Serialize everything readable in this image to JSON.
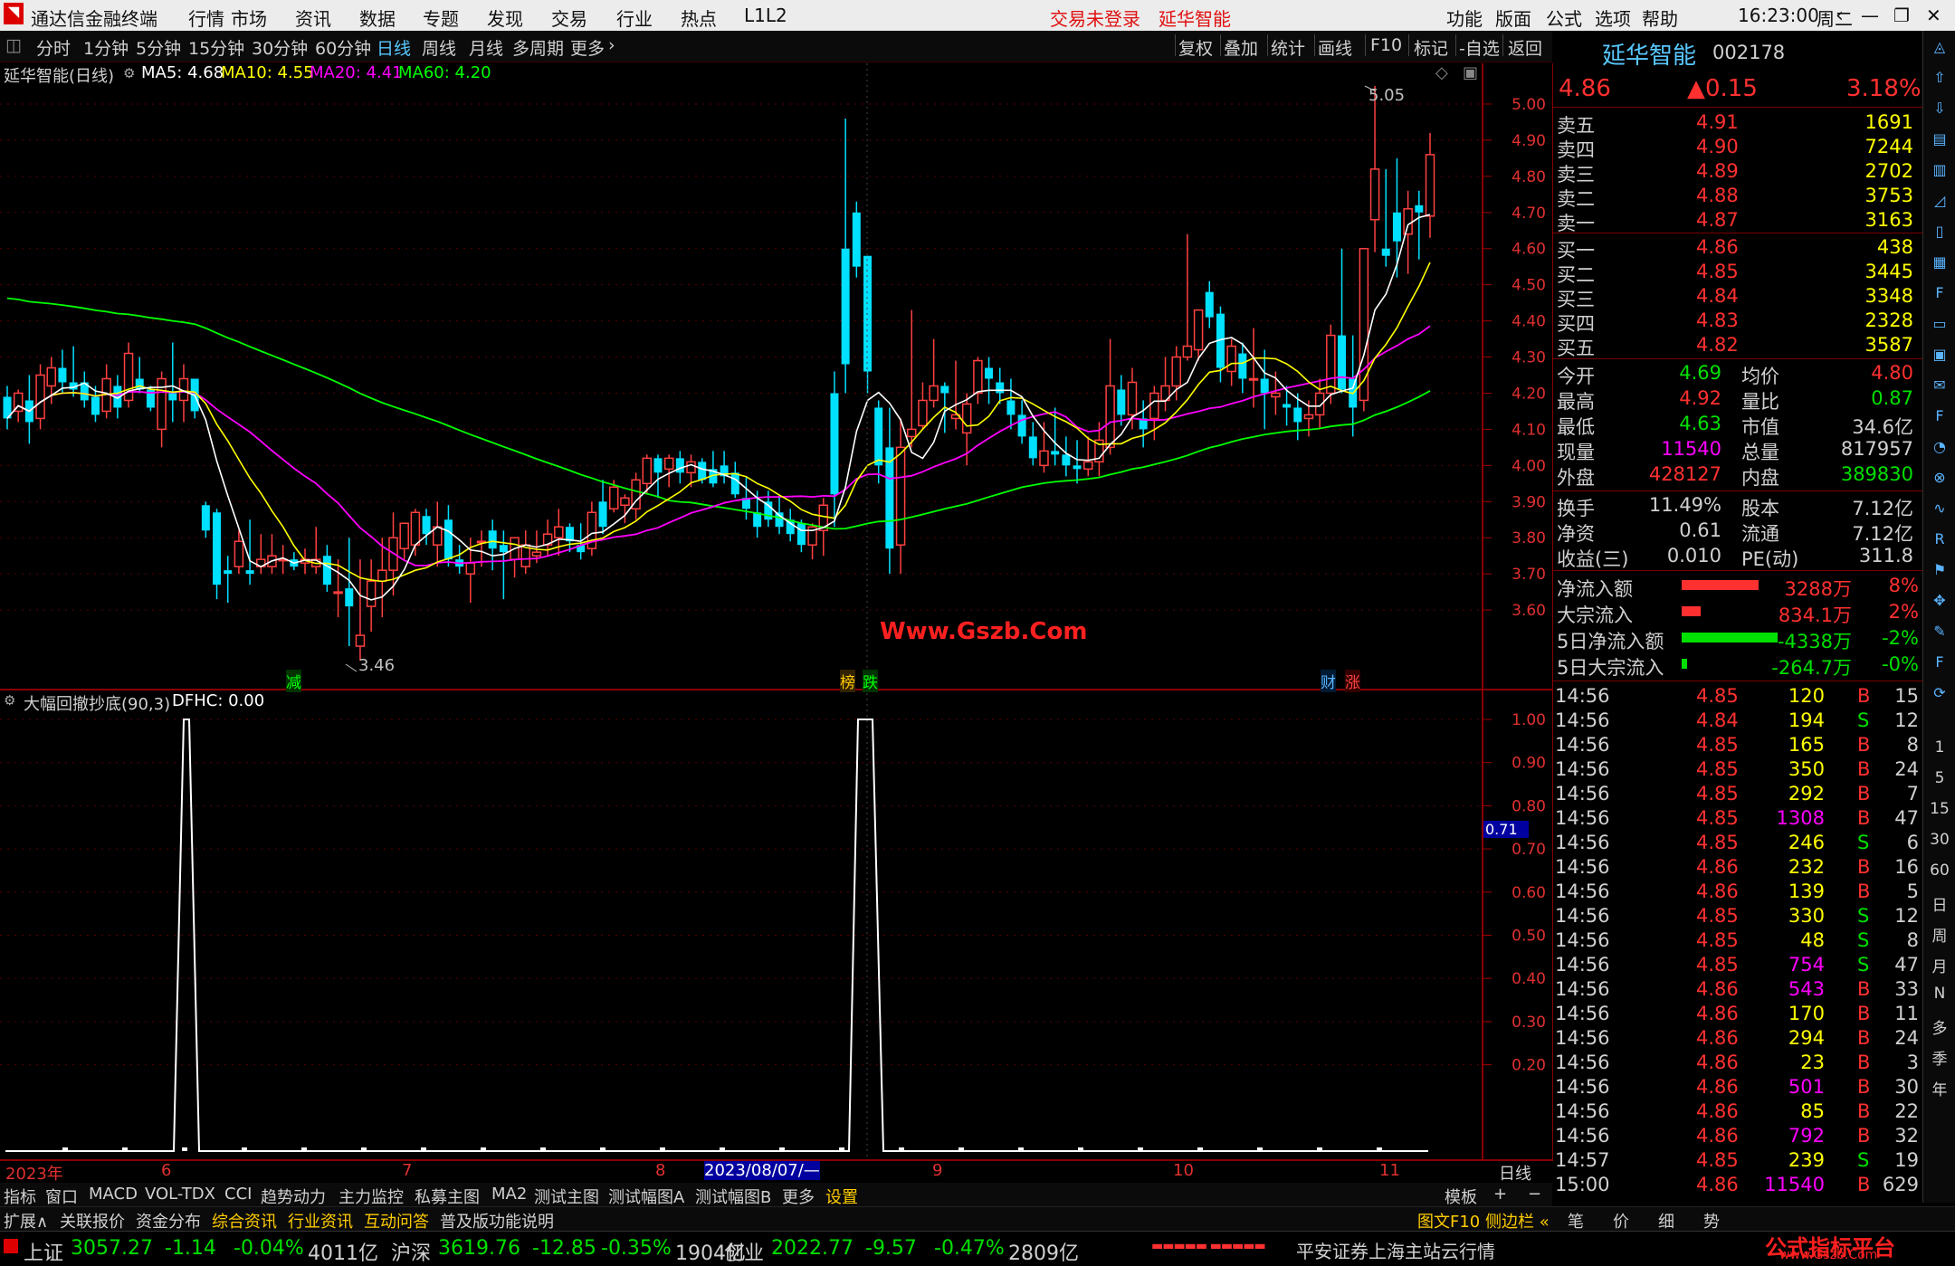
{
  "titlebar": {
    "app_name": "通达信金融终端",
    "menus": [
      "行情",
      "市场",
      "资讯",
      "数据",
      "专题",
      "发现",
      "交易",
      "行业",
      "热点",
      "L1L2"
    ],
    "login_status": "交易未登录",
    "stock_name": "延华智能",
    "right_menus": [
      "功能",
      "版面",
      "公式",
      "选项",
      "帮助"
    ],
    "time": "16:23:00",
    "weekday": "周二"
  },
  "periodbar": {
    "periods": [
      "分时",
      "1分钟",
      "5分钟",
      "15分钟",
      "30分钟",
      "60分钟",
      "日线",
      "周线",
      "月线",
      "多周期",
      "更多"
    ],
    "selected": "日线",
    "tools": [
      "复权",
      "叠加",
      "统计",
      "画线",
      "F10",
      "标记",
      "-自选",
      "返回"
    ]
  },
  "main_chart": {
    "header": "延华智能(日线)",
    "ma5": "MA5: 4.68",
    "ma10": "MA10: 4.55",
    "ma20": "MA20: 4.41",
    "ma60": "MA60: 4.20",
    "high_marker": "5.05",
    "low_marker": "3.46",
    "watermark": "Www.Gszb.Com",
    "event_marks": [
      "减",
      "榜",
      "跌",
      "财",
      "涨"
    ],
    "colors": {
      "up": "#ff4040",
      "down": "#00e0ff",
      "ma5": "#ffffff",
      "ma10": "#ffff00",
      "ma20": "#ff00ff",
      "ma60": "#00ff00"
    }
  },
  "indicator": {
    "header": "大幅回撤抄底(90,3)",
    "value": "DFHC: 0.00",
    "cursor_value": "0.71"
  },
  "time_axis": {
    "labels": [
      "2023年",
      "6",
      "7",
      "8",
      "2023/08/07/—",
      "9",
      "10",
      "11"
    ],
    "period": "日线"
  },
  "tabbar": {
    "tabs": [
      "指标",
      "窗口",
      "MACD",
      "VOL-TDX",
      "CCI",
      "趋势动力",
      "主力监控",
      "私募主图",
      "MA2",
      "测试主图",
      "测试幅图A",
      "测试幅图B",
      "更多",
      "设置"
    ],
    "right": [
      "模板",
      "+",
      "−"
    ]
  },
  "infobar": {
    "items": [
      "扩展∧",
      "关联报价",
      "资金分布",
      "综合资讯",
      "行业资讯",
      "互动问答",
      "普及版功能说明"
    ],
    "right": "图文F10 侧边栏 «",
    "right_tabs": [
      "笔",
      "价",
      "细",
      "势"
    ]
  },
  "statusbar": {
    "indices": [
      {
        "name": "上证",
        "value": "3057.27",
        "chg": "-1.14",
        "pct": "-0.04%",
        "amt": "4011亿"
      },
      {
        "name": "沪深",
        "value": "3619.76",
        "chg": "-12.85",
        "pct": "-0.35%",
        "amt": "1904亿"
      },
      {
        "name": "创业",
        "value": "2022.77",
        "chg": "-9.57",
        "pct": "-0.47%",
        "amt": "2809亿"
      }
    ],
    "broker": "平安证券上海主站云行情",
    "logo": "公式指标平台",
    "logo_url": "www.Gszb.Com"
  },
  "quote": {
    "name": "延华智能",
    "code": "002178",
    "price": "4.86",
    "change": "▲0.15",
    "pct": "3.18%",
    "asks": [
      {
        "label": "卖五",
        "price": "4.91",
        "vol": "1691"
      },
      {
        "label": "卖四",
        "price": "4.90",
        "vol": "7244"
      },
      {
        "label": "卖三",
        "price": "4.89",
        "vol": "2702"
      },
      {
        "label": "卖二",
        "price": "4.88",
        "vol": "3753"
      },
      {
        "label": "卖一",
        "price": "4.87",
        "vol": "3163"
      }
    ],
    "bids": [
      {
        "label": "买一",
        "price": "4.86",
        "vol": "438"
      },
      {
        "label": "买二",
        "price": "4.85",
        "vol": "3445"
      },
      {
        "label": "买三",
        "price": "4.84",
        "vol": "3348"
      },
      {
        "label": "买四",
        "price": "4.83",
        "vol": "2328"
      },
      {
        "label": "买五",
        "price": "4.82",
        "vol": "3587"
      }
    ],
    "stats": [
      {
        "l1": "今开",
        "v1": "4.69",
        "l2": "均价",
        "v2": "4.80"
      },
      {
        "l1": "最高",
        "v1": "4.92",
        "l2": "量比",
        "v2": "0.87"
      },
      {
        "l1": "最低",
        "v1": "4.63",
        "l2": "市值",
        "v2": "34.6亿"
      },
      {
        "l1": "现量",
        "v1": "11540",
        "l2": "总量",
        "v2": "817957"
      },
      {
        "l1": "外盘",
        "v1": "428127",
        "l2": "内盘",
        "v2": "389830"
      }
    ],
    "fundamentals": [
      {
        "l1": "换手",
        "v1": "11.49%",
        "l2": "股本",
        "v2": "7.12亿"
      },
      {
        "l1": "净资",
        "v1": "0.61",
        "l2": "流通",
        "v2": "7.12亿"
      },
      {
        "l1": "收益(三)",
        "v1": "0.010",
        "l2": "PE(动)",
        "v2": "311.8"
      }
    ],
    "flows": [
      {
        "label": "净流入额",
        "value": "3288万",
        "pct": "8%",
        "bar": 0.8,
        "color": "#ff3030"
      },
      {
        "label": "大宗流入",
        "value": "834.1万",
        "pct": "2%",
        "bar": 0.2,
        "color": "#ff3030"
      },
      {
        "label": "5日净流入额",
        "value": "-4338万",
        "pct": "-2%",
        "bar": 1.0,
        "color": "#00e000"
      },
      {
        "label": "5日大宗流入",
        "value": "-264.7万",
        "pct": "-0%",
        "bar": 0.06,
        "color": "#00e000"
      }
    ],
    "ticks": [
      {
        "t": "14:56",
        "p": "4.85",
        "v": "120",
        "d": "B",
        "n": "15"
      },
      {
        "t": "14:56",
        "p": "4.84",
        "v": "194",
        "d": "S",
        "n": "12"
      },
      {
        "t": "14:56",
        "p": "4.85",
        "v": "165",
        "d": "B",
        "n": "8"
      },
      {
        "t": "14:56",
        "p": "4.85",
        "v": "350",
        "d": "B",
        "n": "24"
      },
      {
        "t": "14:56",
        "p": "4.85",
        "v": "292",
        "d": "B",
        "n": "7"
      },
      {
        "t": "14:56",
        "p": "4.85",
        "v": "1308",
        "d": "B",
        "n": "47"
      },
      {
        "t": "14:56",
        "p": "4.85",
        "v": "246",
        "d": "S",
        "n": "6"
      },
      {
        "t": "14:56",
        "p": "4.86",
        "v": "232",
        "d": "B",
        "n": "16"
      },
      {
        "t": "14:56",
        "p": "4.86",
        "v": "139",
        "d": "B",
        "n": "5"
      },
      {
        "t": "14:56",
        "p": "4.85",
        "v": "330",
        "d": "S",
        "n": "12"
      },
      {
        "t": "14:56",
        "p": "4.85",
        "v": "48",
        "d": "S",
        "n": "8"
      },
      {
        "t": "14:56",
        "p": "4.85",
        "v": "754",
        "d": "S",
        "n": "47"
      },
      {
        "t": "14:56",
        "p": "4.86",
        "v": "543",
        "d": "B",
        "n": "33"
      },
      {
        "t": "14:56",
        "p": "4.86",
        "v": "170",
        "d": "B",
        "n": "11"
      },
      {
        "t": "14:56",
        "p": "4.86",
        "v": "294",
        "d": "B",
        "n": "24"
      },
      {
        "t": "14:56",
        "p": "4.86",
        "v": "23",
        "d": "B",
        "n": "3"
      },
      {
        "t": "14:56",
        "p": "4.86",
        "v": "501",
        "d": "B",
        "n": "30"
      },
      {
        "t": "14:56",
        "p": "4.86",
        "v": "85",
        "d": "B",
        "n": "22"
      },
      {
        "t": "14:56",
        "p": "4.86",
        "v": "792",
        "d": "B",
        "n": "32"
      },
      {
        "t": "14:57",
        "p": "4.85",
        "v": "239",
        "d": "S",
        "n": "19"
      },
      {
        "t": "15:00",
        "p": "4.86",
        "v": "11540",
        "d": "B",
        "n": "629"
      }
    ]
  },
  "sidebar_labels": [
    "1",
    "5",
    "15",
    "30",
    "60",
    "日",
    "周",
    "月",
    "N",
    "多",
    "季",
    "年"
  ],
  "chart_data": [
    {
      "type": "candlestick",
      "title": "延华智能(日线)",
      "y_axis_ticks": [
        "5.00",
        "4.90",
        "4.80",
        "4.70",
        "4.60",
        "4.50",
        "4.40",
        "4.30",
        "4.20",
        "4.10",
        "4.00",
        "3.90",
        "3.80",
        "3.70",
        "3.60"
      ],
      "ylim": [
        3.46,
        5.05
      ],
      "ohlc": [
        [
          4.19,
          4.22,
          4.1,
          4.13
        ],
        [
          4.15,
          4.21,
          4.12,
          4.2
        ],
        [
          4.18,
          4.25,
          4.06,
          4.12
        ],
        [
          4.13,
          4.28,
          4.1,
          4.25
        ],
        [
          4.22,
          4.3,
          4.17,
          4.27
        ],
        [
          4.27,
          4.32,
          4.2,
          4.23
        ],
        [
          4.23,
          4.33,
          4.19,
          4.21
        ],
        [
          4.23,
          4.26,
          4.16,
          4.18
        ],
        [
          4.19,
          4.22,
          4.12,
          4.14
        ],
        [
          4.15,
          4.28,
          4.13,
          4.24
        ],
        [
          4.22,
          4.25,
          4.13,
          4.16
        ],
        [
          4.18,
          4.34,
          4.16,
          4.31
        ],
        [
          4.24,
          4.3,
          4.2,
          4.21
        ],
        [
          4.21,
          4.22,
          4.15,
          4.16
        ],
        [
          4.1,
          4.26,
          4.05,
          4.24
        ],
        [
          4.2,
          4.34,
          4.12,
          4.18
        ],
        [
          4.18,
          4.28,
          4.12,
          4.24
        ],
        [
          4.24,
          4.24,
          4.13,
          4.15
        ],
        [
          3.89,
          3.9,
          3.8,
          3.82
        ],
        [
          3.87,
          3.88,
          3.63,
          3.67
        ],
        [
          3.71,
          3.75,
          3.62,
          3.7
        ],
        [
          3.72,
          3.82,
          3.7,
          3.79
        ],
        [
          3.71,
          3.85,
          3.67,
          3.7
        ],
        [
          3.72,
          3.81,
          3.7,
          3.74
        ],
        [
          3.72,
          3.81,
          3.7,
          3.75
        ],
        [
          3.74,
          3.78,
          3.7,
          3.74
        ],
        [
          3.74,
          3.76,
          3.71,
          3.72
        ],
        [
          3.73,
          3.77,
          3.7,
          3.74
        ],
        [
          3.72,
          3.83,
          3.7,
          3.74
        ],
        [
          3.75,
          3.78,
          3.65,
          3.67
        ],
        [
          3.65,
          3.74,
          3.58,
          3.65
        ],
        [
          3.66,
          3.8,
          3.5,
          3.61
        ],
        [
          3.5,
          3.74,
          3.46,
          3.53
        ],
        [
          3.61,
          3.74,
          3.54,
          3.68
        ],
        [
          3.68,
          3.8,
          3.58,
          3.71
        ],
        [
          3.71,
          3.87,
          3.64,
          3.8
        ],
        [
          3.77,
          3.84,
          3.74,
          3.84
        ],
        [
          3.78,
          3.88,
          3.75,
          3.87
        ],
        [
          3.86,
          3.88,
          3.78,
          3.81
        ],
        [
          3.78,
          3.9,
          3.72,
          3.83
        ],
        [
          3.85,
          3.89,
          3.72,
          3.74
        ],
        [
          3.74,
          3.78,
          3.7,
          3.72
        ],
        [
          3.7,
          3.8,
          3.62,
          3.73
        ],
        [
          3.79,
          3.82,
          3.72,
          3.79
        ],
        [
          3.82,
          3.85,
          3.71,
          3.77
        ],
        [
          3.78,
          3.82,
          3.63,
          3.76
        ],
        [
          3.74,
          3.8,
          3.69,
          3.8
        ],
        [
          3.72,
          3.82,
          3.7,
          3.78
        ],
        [
          3.75,
          3.82,
          3.73,
          3.76
        ],
        [
          3.78,
          3.85,
          3.75,
          3.81
        ],
        [
          3.8,
          3.88,
          3.75,
          3.83
        ],
        [
          3.83,
          3.84,
          3.76,
          3.79
        ],
        [
          3.78,
          3.84,
          3.74,
          3.76
        ],
        [
          3.77,
          3.9,
          3.75,
          3.87
        ],
        [
          3.9,
          3.96,
          3.81,
          3.83
        ],
        [
          3.88,
          3.96,
          3.87,
          3.94
        ],
        [
          3.89,
          3.92,
          3.84,
          3.91
        ],
        [
          3.88,
          3.98,
          3.85,
          3.96
        ],
        [
          3.95,
          4.03,
          3.92,
          4.02
        ],
        [
          4.02,
          4.03,
          3.91,
          3.98
        ],
        [
          3.99,
          4.03,
          3.94,
          4.02
        ],
        [
          4.02,
          4.04,
          3.95,
          3.98
        ],
        [
          3.98,
          4.03,
          3.94,
          4.01
        ],
        [
          4.01,
          4.02,
          3.95,
          3.96
        ],
        [
          3.99,
          4.04,
          3.94,
          3.95
        ],
        [
          4.0,
          4.04,
          3.95,
          3.97
        ],
        [
          3.98,
          4.01,
          3.91,
          3.92
        ],
        [
          3.91,
          3.97,
          3.85,
          3.88
        ],
        [
          3.87,
          3.93,
          3.8,
          3.83
        ],
        [
          3.9,
          3.93,
          3.83,
          3.85
        ],
        [
          3.87,
          3.92,
          3.81,
          3.83
        ],
        [
          3.85,
          3.88,
          3.79,
          3.81
        ],
        [
          3.84,
          3.85,
          3.76,
          3.78
        ],
        [
          3.78,
          3.84,
          3.74,
          3.83
        ],
        [
          3.82,
          3.91,
          3.75,
          3.89
        ],
        [
          4.2,
          4.26,
          3.83,
          3.92
        ],
        [
          4.6,
          4.96,
          4.2,
          4.28
        ],
        [
          4.7,
          4.73,
          4.52,
          4.55
        ],
        [
          4.58,
          4.58,
          4.2,
          4.26
        ],
        [
          4.16,
          4.18,
          3.95,
          4.0
        ],
        [
          4.05,
          4.16,
          3.7,
          3.77
        ],
        [
          3.78,
          4.13,
          3.7,
          4.05
        ],
        [
          4.08,
          4.43,
          4.05,
          4.1
        ],
        [
          4.11,
          4.23,
          4.1,
          4.18
        ],
        [
          4.18,
          4.35,
          4.16,
          4.22
        ],
        [
          4.22,
          4.23,
          4.09,
          4.2
        ],
        [
          4.13,
          4.29,
          4.1,
          4.14
        ],
        [
          4.09,
          4.2,
          4.0,
          4.17
        ],
        [
          4.2,
          4.3,
          4.17,
          4.29
        ],
        [
          4.27,
          4.3,
          4.17,
          4.24
        ],
        [
          4.23,
          4.27,
          4.17,
          4.2
        ],
        [
          4.18,
          4.24,
          4.1,
          4.14
        ],
        [
          4.14,
          4.18,
          4.06,
          4.08
        ],
        [
          4.08,
          4.12,
          4.0,
          4.02
        ],
        [
          4.0,
          4.12,
          3.98,
          4.04
        ],
        [
          4.04,
          4.16,
          4.0,
          4.03
        ],
        [
          4.03,
          4.08,
          3.97,
          4.0
        ],
        [
          4.0,
          4.07,
          3.95,
          3.99
        ],
        [
          3.99,
          4.08,
          3.97,
          4.01
        ],
        [
          4.01,
          4.12,
          3.97,
          4.07
        ],
        [
          4.05,
          4.35,
          4.03,
          4.22
        ],
        [
          4.21,
          4.25,
          4.11,
          4.14
        ],
        [
          4.14,
          4.27,
          4.1,
          4.23
        ],
        [
          4.13,
          4.18,
          4.05,
          4.1
        ],
        [
          4.13,
          4.22,
          4.07,
          4.2
        ],
        [
          4.18,
          4.3,
          4.15,
          4.22
        ],
        [
          4.22,
          4.33,
          4.18,
          4.3
        ],
        [
          4.3,
          4.64,
          4.29,
          4.33
        ],
        [
          4.32,
          4.43,
          4.29,
          4.43
        ],
        [
          4.48,
          4.51,
          4.38,
          4.41
        ],
        [
          4.42,
          4.44,
          4.23,
          4.27
        ],
        [
          4.26,
          4.35,
          4.22,
          4.33
        ],
        [
          4.31,
          4.34,
          4.2,
          4.24
        ],
        [
          4.24,
          4.38,
          4.16,
          4.24
        ],
        [
          4.24,
          4.32,
          4.1,
          4.2
        ],
        [
          4.19,
          4.26,
          4.14,
          4.2
        ],
        [
          4.17,
          4.22,
          4.11,
          4.16
        ],
        [
          4.16,
          4.2,
          4.07,
          4.12
        ],
        [
          4.13,
          4.18,
          4.08,
          4.14
        ],
        [
          4.14,
          4.24,
          4.1,
          4.2
        ],
        [
          4.2,
          4.39,
          4.17,
          4.36
        ],
        [
          4.36,
          4.6,
          4.2,
          4.21
        ],
        [
          4.24,
          4.36,
          4.08,
          4.16
        ],
        [
          4.18,
          4.6,
          4.15,
          4.6
        ],
        [
          4.68,
          5.05,
          4.59,
          4.82
        ],
        [
          4.6,
          4.82,
          4.55,
          4.58
        ],
        [
          4.7,
          4.85,
          4.52,
          4.62
        ],
        [
          4.64,
          4.76,
          4.53,
          4.71
        ],
        [
          4.72,
          4.76,
          4.57,
          4.7
        ],
        [
          4.69,
          4.92,
          4.63,
          4.86
        ]
      ],
      "ma": {
        "MA5": 4.68,
        "MA10": 4.55,
        "MA20": 4.41,
        "MA60": 4.2
      }
    },
    {
      "type": "line",
      "title": "大幅回撤抄底(90,3)",
      "series": [
        {
          "name": "DFHC",
          "values_spikes": [
            {
              "index": 3,
              "value": 1.0
            },
            {
              "index": 15,
              "value": 1.0
            }
          ]
        }
      ],
      "y_axis_ticks": [
        "1.00",
        "0.90",
        "0.80",
        "0.70",
        "0.60",
        "0.50",
        "0.40",
        "0.30",
        "0.20"
      ],
      "ylim": [
        0,
        1.0
      ]
    }
  ]
}
